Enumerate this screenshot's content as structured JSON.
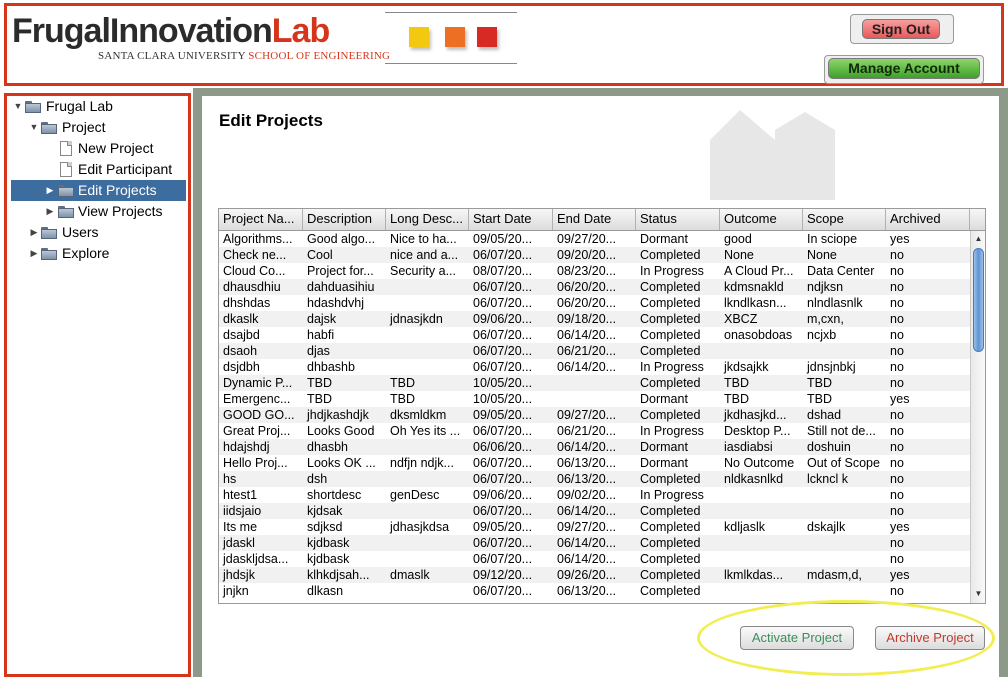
{
  "header": {
    "logo_main_a": "FrugalInnovation",
    "logo_main_b": "Lab",
    "logo_sub_a": "SANTA CLARA UNIVERSITY",
    "logo_sub_b": "SCHOOL OF ENGINEERING",
    "sign_out_label": "Sign Out",
    "manage_account_label": "Manage Account",
    "square_colors": [
      "#f2c811",
      "#ec6f24",
      "#d82a25"
    ]
  },
  "sidebar": {
    "items": [
      {
        "label": "Frugal Lab",
        "icon": "folder-open-icon",
        "expander": "expanded"
      },
      {
        "label": "Project",
        "icon": "folder-open-icon",
        "expander": "expanded"
      },
      {
        "label": "New Project",
        "icon": "document-icon"
      },
      {
        "label": "Edit Participant",
        "icon": "document-icon"
      },
      {
        "label": "Edit Projects",
        "icon": "folder-icon",
        "expander": "collapsed",
        "selected": true
      },
      {
        "label": "View Projects",
        "icon": "folder-icon",
        "expander": "collapsed"
      },
      {
        "label": "Users",
        "icon": "folder-icon",
        "expander": "collapsed"
      },
      {
        "label": "Explore",
        "icon": "folder-icon",
        "expander": "collapsed"
      }
    ]
  },
  "main": {
    "title": "Edit Projects",
    "table": {
      "columns": [
        "Project Na...",
        "Description",
        "Long Desc...",
        "Start Date",
        "End Date",
        "Status",
        "Outcome",
        "Scope",
        "Archived"
      ],
      "rows": [
        [
          "Algorithms...",
          "Good algo...",
          "Nice to ha...",
          "09/05/20...",
          "09/27/20...",
          "Dormant",
          "good",
          "In sciope",
          "yes"
        ],
        [
          "Check ne...",
          "Cool",
          "nice and a...",
          "06/07/20...",
          "09/20/20...",
          "Completed",
          "None",
          "None",
          "no"
        ],
        [
          "Cloud Co...",
          "Project for...",
          "Security a...",
          "08/07/20...",
          "08/23/20...",
          "In Progress",
          "A Cloud Pr...",
          "Data Center",
          "no"
        ],
        [
          "dhausdhiu",
          "dahduasihiu",
          "",
          "06/07/20...",
          "06/20/20...",
          "Completed",
          "kdmsnakld",
          "ndjksn",
          "no"
        ],
        [
          "dhshdas",
          "hdashdvhj",
          "",
          "06/07/20...",
          "06/20/20...",
          "Completed",
          "lkndlkasn...",
          "nlndlasnlk",
          "no"
        ],
        [
          "dkaslk",
          "dajsk",
          "jdnasjkdn",
          "09/06/20...",
          "09/18/20...",
          "Completed",
          "XBCZ",
          "m,cxn,",
          "no"
        ],
        [
          "dsajbd",
          "habfi",
          "",
          "06/07/20...",
          "06/14/20...",
          "Completed",
          "onasobdoas",
          "ncjxb",
          "no"
        ],
        [
          "dsaoh",
          "djas",
          "",
          "06/07/20...",
          "06/21/20...",
          "Completed",
          "",
          "",
          "no"
        ],
        [
          "dsjdbh",
          "dhbashb",
          "",
          "06/07/20...",
          "06/14/20...",
          "In Progress",
          "jkdsajkk",
          "jdnsjnbkj",
          "no"
        ],
        [
          "Dynamic P...",
          "TBD",
          "TBD",
          "10/05/20...",
          "",
          "Completed",
          "TBD",
          "TBD",
          "no"
        ],
        [
          "Emergenc...",
          "TBD",
          "TBD",
          "10/05/20...",
          "",
          "Dormant",
          "TBD",
          "TBD",
          "yes"
        ],
        [
          "GOOD GO...",
          "jhdjkashdjk",
          "dksmldkm",
          "09/05/20...",
          "09/27/20...",
          "Completed",
          "jkdhasjkd...",
          "dshad",
          "no"
        ],
        [
          "Great Proj...",
          "Looks Good",
          "Oh Yes its ...",
          "06/07/20...",
          "06/21/20...",
          "In Progress",
          "Desktop P...",
          "Still not de...",
          "no"
        ],
        [
          "hdajshdj",
          "dhasbh",
          "",
          "06/06/20...",
          "06/14/20...",
          "Dormant",
          "iasdiabsi",
          "doshuin",
          "no"
        ],
        [
          "Hello Proj...",
          "Looks OK ...",
          "ndfjn ndjk...",
          "06/07/20...",
          "06/13/20...",
          "Dormant",
          "No Outcome",
          "Out of Scope",
          "no"
        ],
        [
          "hs",
          "dsh",
          "",
          "06/07/20...",
          "06/13/20...",
          "Completed",
          "nldkasnlkd",
          "lckncl k",
          "no"
        ],
        [
          "htest1",
          "shortdesc",
          "genDesc",
          "09/06/20...",
          "09/02/20...",
          "In Progress",
          "",
          "",
          "no"
        ],
        [
          "iidsjaio",
          "kjdsak",
          "",
          "06/07/20...",
          "06/14/20...",
          "Completed",
          "",
          "",
          "no"
        ],
        [
          "Its me",
          "sdjksd",
          "jdhasjkdsa",
          "09/05/20...",
          "09/27/20...",
          "Completed",
          "kdljaslk",
          "dskajlk",
          "yes"
        ],
        [
          "jdaskl",
          "kjdbask",
          "",
          "06/07/20...",
          "06/14/20...",
          "Completed",
          "",
          "",
          "no"
        ],
        [
          "jdaskljdsa...",
          "kjdbask",
          "",
          "06/07/20...",
          "06/14/20...",
          "Completed",
          "",
          "",
          "no"
        ],
        [
          "jhdsjk",
          "klhkdjsah...",
          "dmaslk",
          "09/12/20...",
          "09/26/20...",
          "Completed",
          "lkmlkdas...",
          "mdasm,d,",
          "yes"
        ],
        [
          "jnjkn",
          "dlkasn",
          "",
          "06/07/20...",
          "06/13/20...",
          "Completed",
          "",
          "",
          "no"
        ]
      ]
    },
    "activate_label": "Activate Project",
    "archive_label": "Archive Project",
    "colors": {
      "activate_text": "#3b8f5a",
      "archive_text": "#c23a2b",
      "selection": "#3d6c9e",
      "frame_red": "#d6351b"
    }
  }
}
